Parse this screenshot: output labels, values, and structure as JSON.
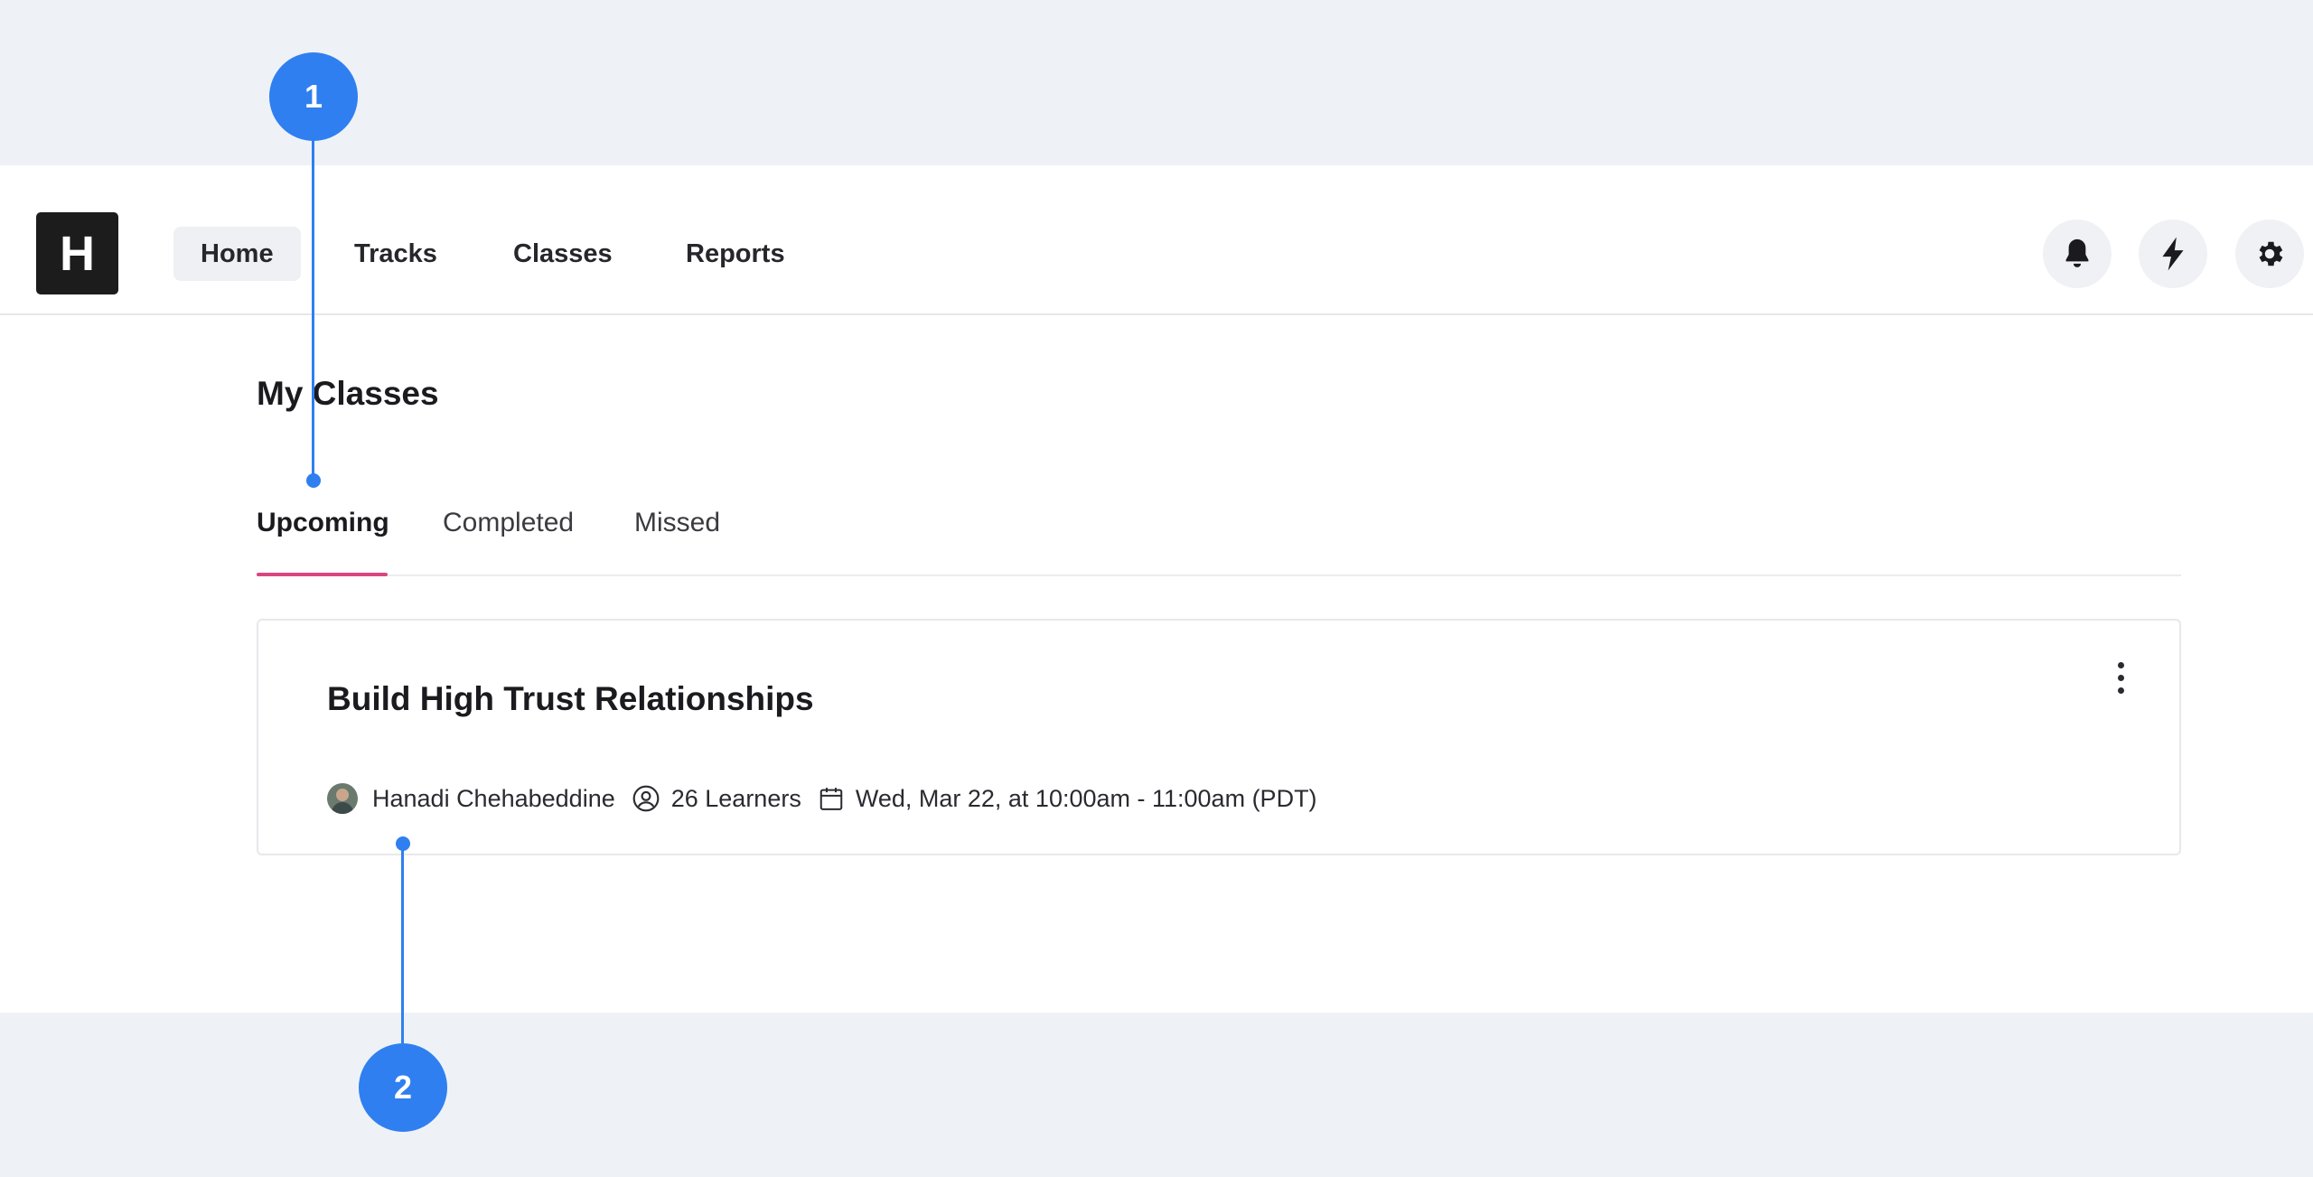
{
  "app": {
    "logo_letter": "H",
    "nav": [
      {
        "label": "Home",
        "active": true
      },
      {
        "label": "Tracks",
        "active": false
      },
      {
        "label": "Classes",
        "active": false
      },
      {
        "label": "Reports",
        "active": false
      }
    ],
    "actions": [
      "bell-icon",
      "bolt-icon",
      "gear-icon"
    ]
  },
  "page": {
    "title": "My Classes",
    "tabs": [
      {
        "label": "Upcoming",
        "active": true
      },
      {
        "label": "Completed",
        "active": false
      },
      {
        "label": "Missed",
        "active": false
      }
    ],
    "accent_color": "#d9467f"
  },
  "card": {
    "title": "Build High Trust Relationships",
    "instructor": "Hanadi Chehabeddine",
    "learners": "26 Learners",
    "schedule": "Wed, Mar 22, at 10:00am - 11:00am (PDT)"
  },
  "callouts": [
    {
      "number": "1",
      "color": "#2f7ff0"
    },
    {
      "number": "2",
      "color": "#2f7ff0"
    }
  ]
}
